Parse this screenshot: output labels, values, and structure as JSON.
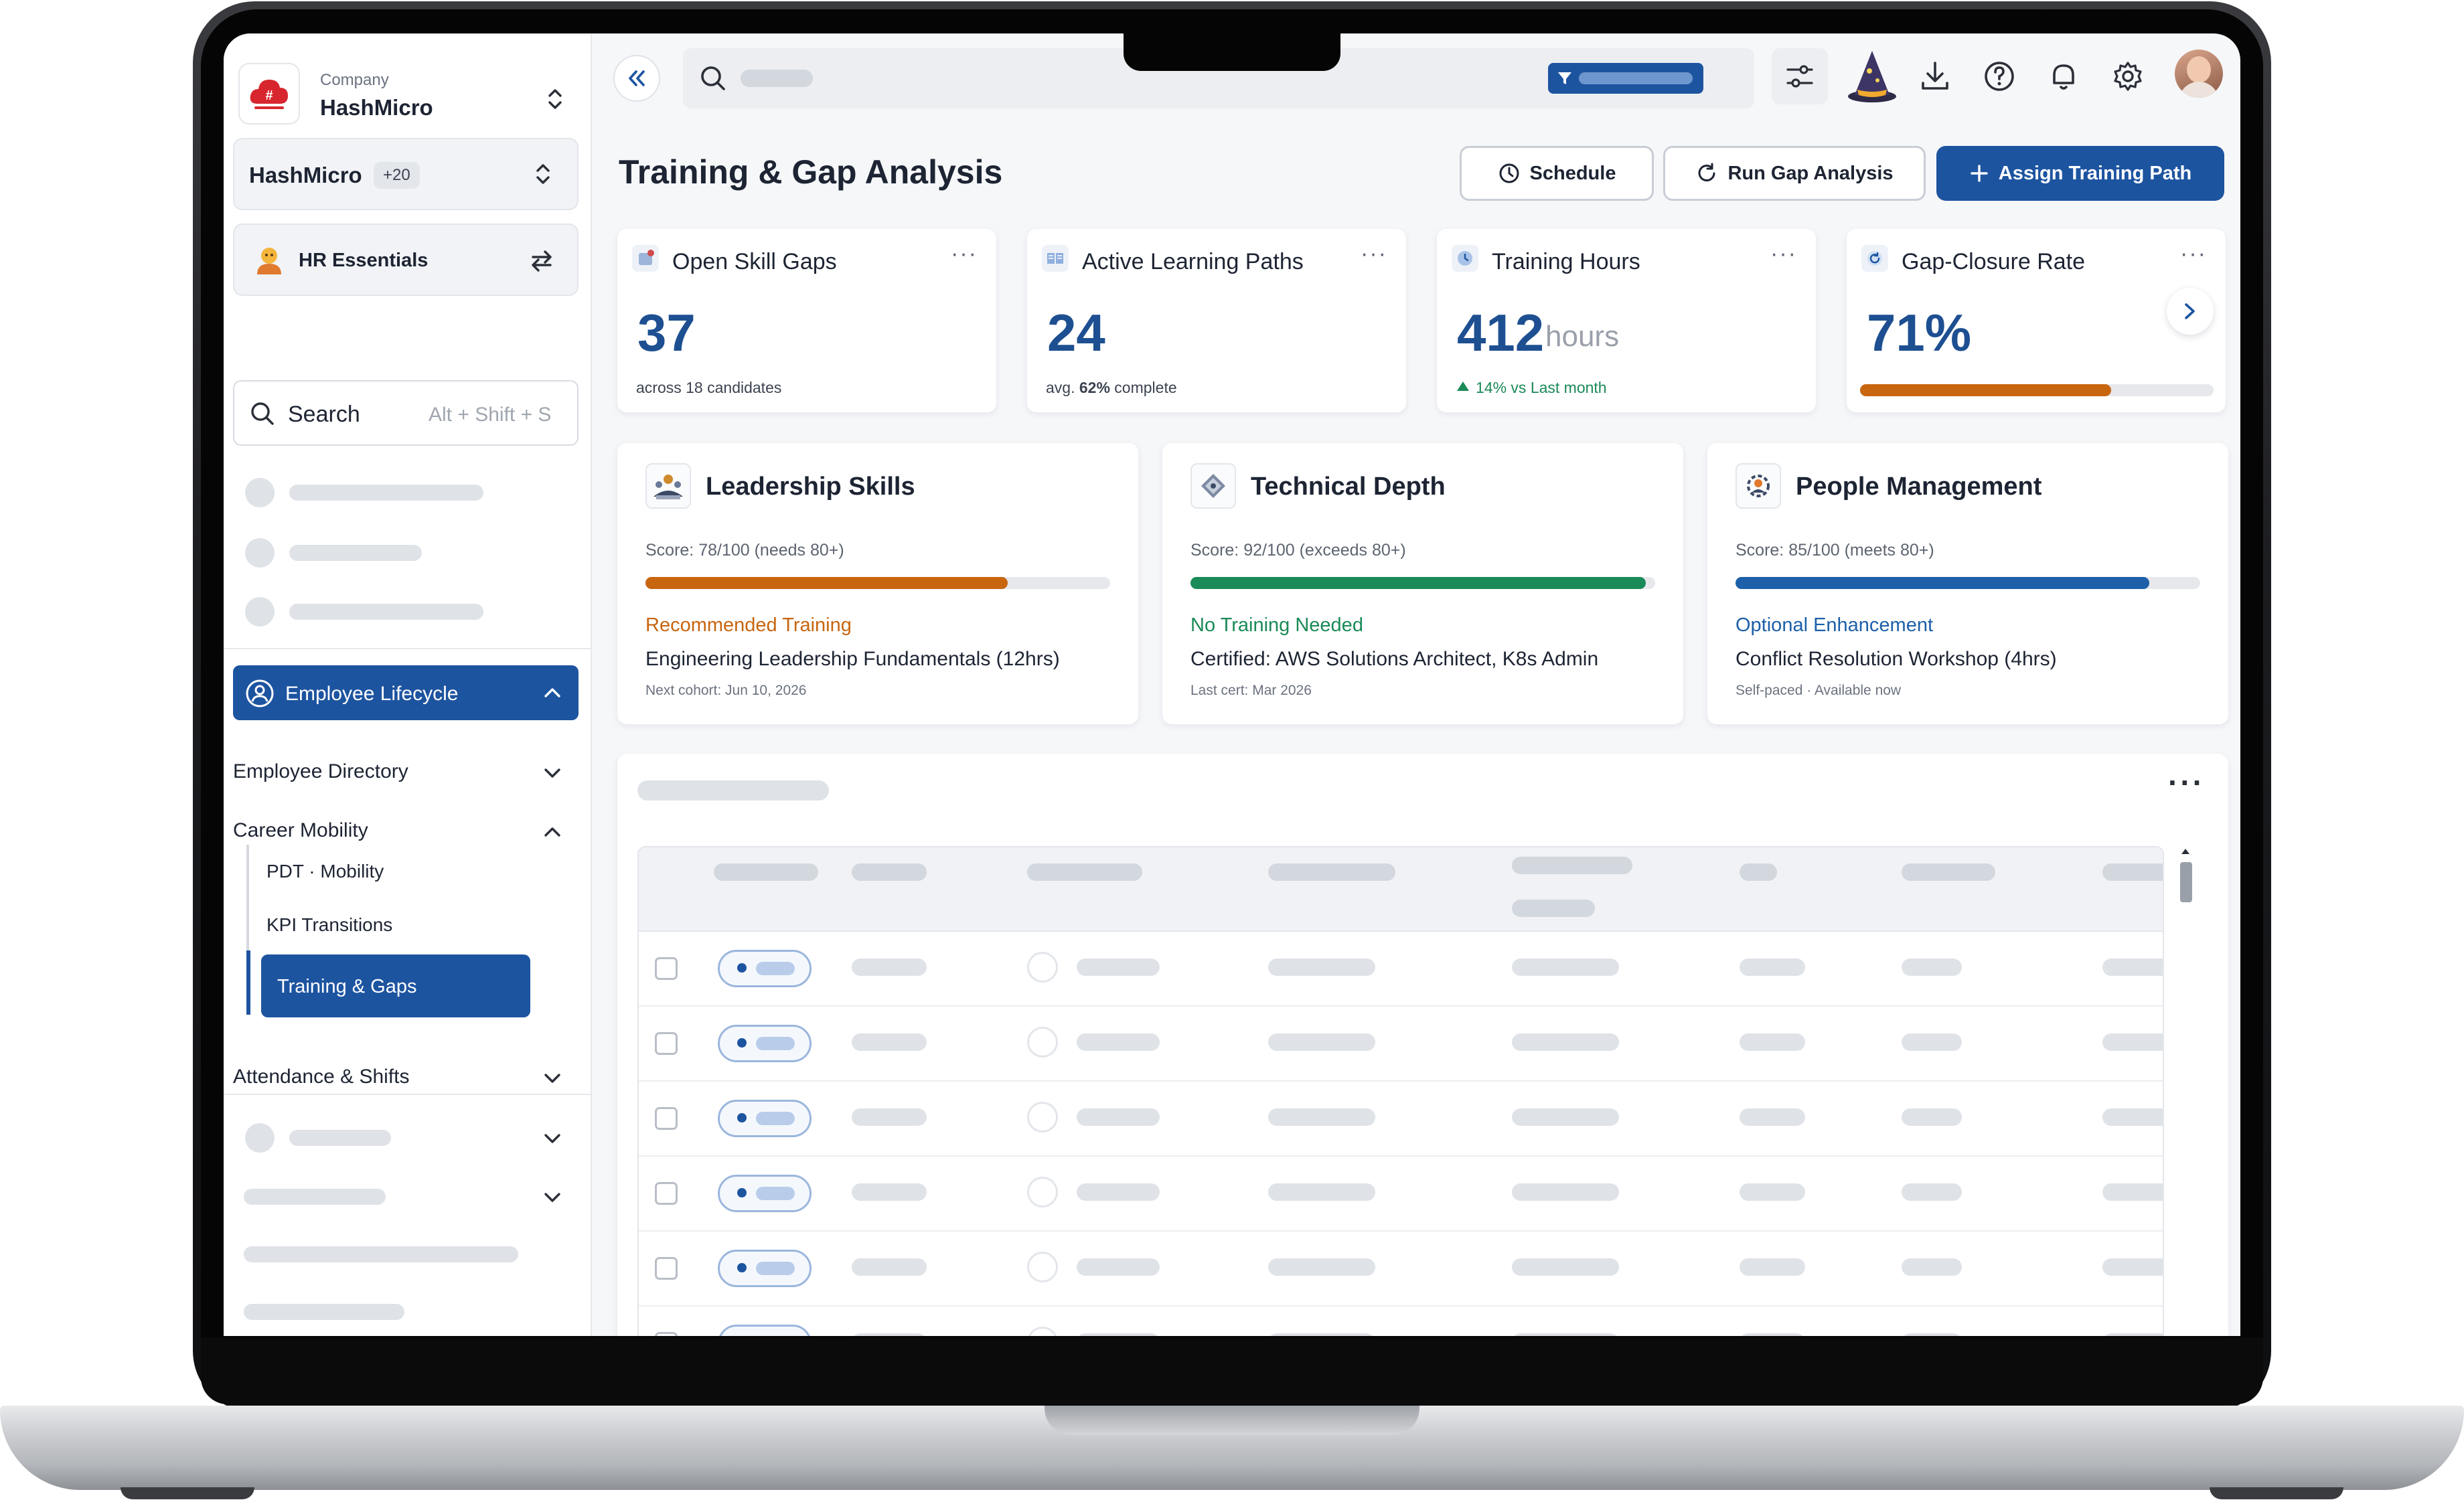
{
  "sidebar": {
    "company_caption": "Company",
    "company_name": "HashMicro",
    "org_name": "HashMicro",
    "org_badge": "+20",
    "module_name": "HR Essentials",
    "search": {
      "placeholder": "Search",
      "shortcut": "Alt + Shift + S"
    },
    "lifecycle_label": "Employee Lifecycle",
    "items": [
      {
        "label": "Employee Directory"
      },
      {
        "label": "Career Mobility"
      },
      {
        "label": "PDT · Mobility"
      },
      {
        "label": "KPI Transitions"
      },
      {
        "label": "Training & Gaps"
      },
      {
        "label": "Attendance & Shifts"
      }
    ]
  },
  "header": {
    "page_title": "Training & Gap Analysis",
    "schedule_label": "Schedule",
    "run_gap_label": "Run Gap Analysis",
    "assign_label": "Assign Training Path"
  },
  "kpis": [
    {
      "title": "Open Skill Gaps",
      "value": "37",
      "unit": "",
      "sub_prefix": "across 18 candidates",
      "sub_bold": "",
      "sub_suffix": ""
    },
    {
      "title": "Active Learning Paths",
      "value": "24",
      "unit": "",
      "sub_prefix": "avg. ",
      "sub_bold": "62%",
      "sub_suffix": " complete"
    },
    {
      "title": "Training Hours",
      "value": "412",
      "unit": "hours",
      "sub_prefix": "14% vs Last month",
      "sub_bold": "",
      "sub_suffix": ""
    },
    {
      "title": "Gap-Closure Rate",
      "value": "71%",
      "unit": "",
      "progress": 0.71
    }
  ],
  "skills": [
    {
      "title": "Leadership Skills",
      "score": "Score: 78/100 (needs 80+)",
      "progress": 0.78,
      "color": "#c8650f",
      "rec_label": "Recommended Training",
      "course": "Engineering Leadership Fundamentals (12hrs)",
      "meta": "Next cohort: Jun 10, 2026"
    },
    {
      "title": "Technical Depth",
      "score": "Score: 92/100 (exceeds 80+)",
      "progress": 0.98,
      "color": "#1a8a57",
      "rec_label": "No Training Needed",
      "course": "Certified: AWS Solutions Architect, K8s Admin",
      "meta": "Last cert: Mar 2026"
    },
    {
      "title": "People Management",
      "score": "Score: 85/100 (meets 80+)",
      "progress": 0.89,
      "color": "#1d5fa8",
      "rec_label": "Optional Enhancement",
      "course": "Conflict Resolution Workshop (4hrs)",
      "meta": "Self-paced · Available now"
    }
  ],
  "colors": {
    "primary": "#1d54a0",
    "value_blue": "#1d4f91",
    "warning": "#c8650f",
    "success": "#1a8a57",
    "info": "#1d5fa8",
    "trend_up": "#1a8a57"
  },
  "icons": [
    "hashmicro-logo-icon",
    "unfold-icon",
    "swap-icon",
    "search-icon",
    "collapse-icon",
    "filter-icon",
    "sliders-icon",
    "wizard-icon",
    "download-icon",
    "help-icon",
    "bell-icon",
    "gear-icon",
    "avatar",
    "clock-icon",
    "refresh-icon",
    "plus-icon",
    "more-icon",
    "chevron-right-icon",
    "chevron-down-icon",
    "chevron-up-icon",
    "trend-up-icon"
  ]
}
